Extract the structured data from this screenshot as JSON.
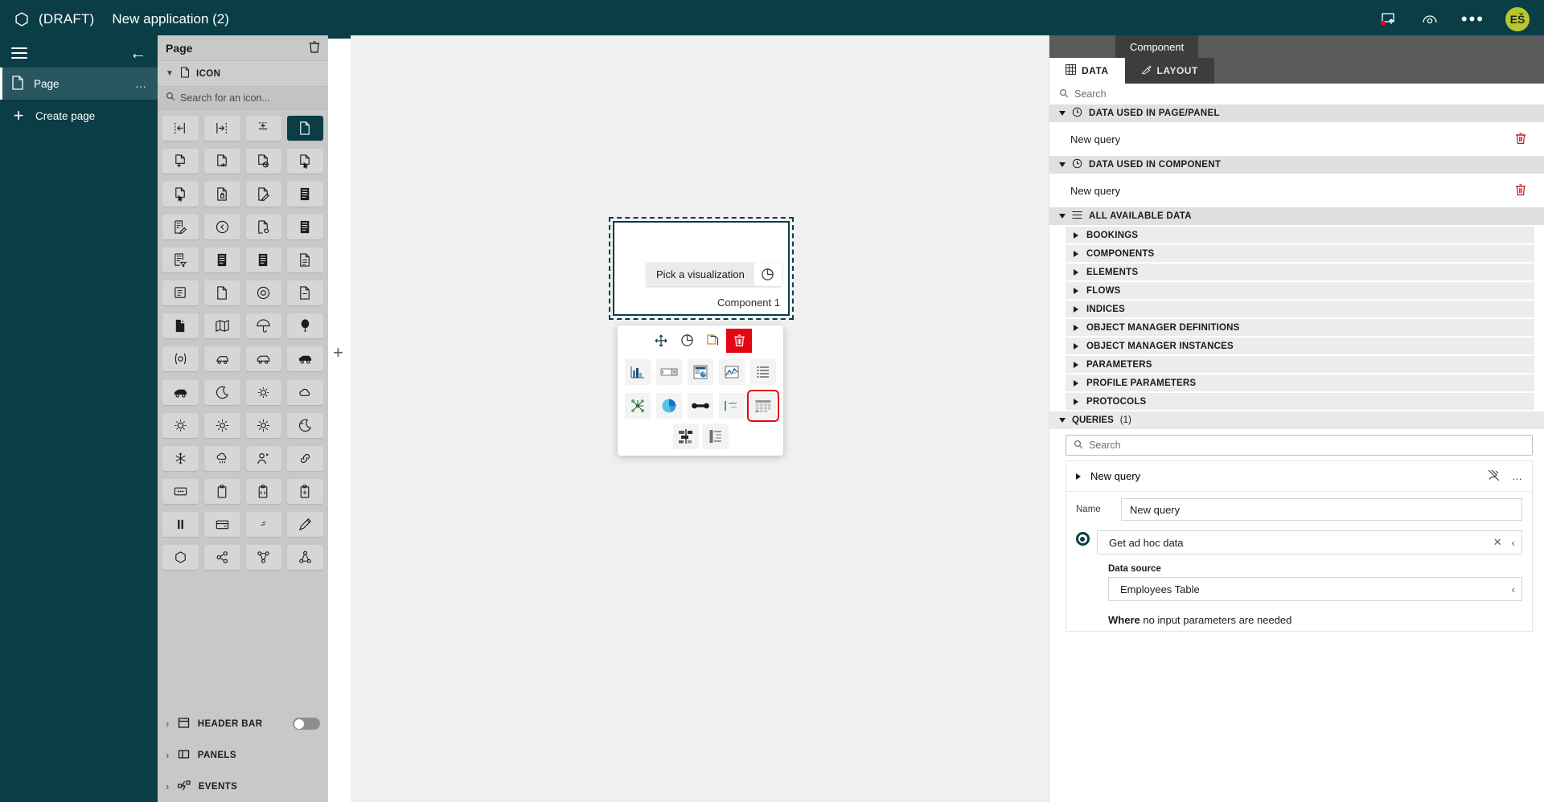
{
  "topbar": {
    "logo_icon": "hexagon-logo-icon",
    "draft_label": "(DRAFT)",
    "title": "New application (2)",
    "present_icon": "present-screen-icon",
    "preview_icon": "preview-eye-icon",
    "more_icon": "more-options-icon",
    "more_label": "•••",
    "avatar_initials": "EŠ"
  },
  "leftnav": {
    "menu_icon": "hamburger-menu-icon",
    "collapse_icon": "collapse-left-arrow-icon",
    "items": [
      {
        "label": "Page",
        "icon": "page-document-icon",
        "active": true,
        "more": "…"
      },
      {
        "label": "Create page",
        "icon": "plus-icon",
        "active": false
      }
    ]
  },
  "properties_panel": {
    "header_title": "Page",
    "delete_icon": "trash-icon",
    "icon_section": {
      "label": "ICON",
      "expanded": true,
      "icon": "page-document-icon",
      "search_placeholder": "Search for an icon...",
      "search_value": "",
      "selected_index": 3,
      "icons": [
        "align-left-icon",
        "align-right-icon",
        "align-top-icon",
        "page-blank-icon",
        "page-add-icon",
        "page-arrow-icon",
        "page-block-icon",
        "page-cursor-icon",
        "page-cursor-alt-icon",
        "page-lock-icon",
        "page-edit-icon",
        "page-lines-icon",
        "page-edit-pen-icon",
        "clock-back-icon",
        "page-link-icon",
        "list-lines-icon",
        "page-filter-icon",
        "list-dark-icon",
        "list-dark-alt-icon",
        "page-lines-alt-icon",
        "note-edit-icon",
        "page-plain-icon",
        "clock-icon",
        "page-note-icon",
        "page-fill-icon",
        "map-icon",
        "umbrella-icon",
        "balloon-icon",
        "bracket-icon",
        "car-icon",
        "car-alt-icon",
        "car-side-icon",
        "car-front-icon",
        "moon-icon",
        "sun-cloud-icon",
        "cloud-icon",
        "sun-icon",
        "sun-bright-icon",
        "sun-star-icon",
        "moon-night-icon",
        "snow-icon",
        "cloud-rain-icon",
        "person-pin-icon",
        "link-icon",
        "dots-box-icon",
        "clipboard-icon",
        "clipboard-code-icon",
        "clipboard-add-icon",
        "pause-icon",
        "card-icon",
        "feather-icon",
        "pen-icon",
        "hexagon-icon",
        "share-node-icon",
        "share-nodes-icon",
        "network-icon"
      ]
    },
    "bottom_sections": [
      {
        "label": "HEADER BAR",
        "icon": "header-bar-icon",
        "has_toggle": true,
        "toggle_on": false
      },
      {
        "label": "PANELS",
        "icon": "panels-icon",
        "has_toggle": false
      },
      {
        "label": "EVENTS",
        "icon": "events-icon",
        "has_toggle": false
      }
    ]
  },
  "canvas": {
    "add_icon": "add-component-icon",
    "component": {
      "pick_label": "Pick a visualization",
      "pick_icon": "pie-chart-icon",
      "name": "Component 1"
    },
    "vis_popup": {
      "toolbar": [
        {
          "name": "move-icon",
          "glyph": "move"
        },
        {
          "name": "pie-chart-icon",
          "glyph": "pie"
        },
        {
          "name": "copy-icon",
          "glyph": "copy"
        },
        {
          "name": "delete-icon",
          "glyph": "trash",
          "danger": true
        }
      ],
      "options_row1": [
        "bar-chart-icon",
        "input-field-icon",
        "dashboard-card-icon",
        "line-chart-icon",
        "list-view-icon"
      ],
      "options_row2": [
        "network-graph-icon",
        "pie-chart-icon",
        "gauge-bar-icon",
        "name-value-icon",
        "table-grid-icon"
      ],
      "options_row3": [
        "gantt-icon",
        "tree-list-icon"
      ],
      "selected_option": "table-grid-icon",
      "selection_color": "#e30613"
    }
  },
  "right_panel": {
    "floating_tab": "Component",
    "tabs": [
      {
        "label": "DATA",
        "icon": "grid-icon",
        "active": true
      },
      {
        "label": "LAYOUT",
        "icon": "brush-icon",
        "active": false
      }
    ],
    "search_placeholder": "Search",
    "search_value": "",
    "groups": [
      {
        "label": "DATA USED IN PAGE/PANEL",
        "icon": "history-clock-icon",
        "expanded": true,
        "rows": [
          {
            "label": "New query",
            "delete_icon": "trash-icon"
          }
        ]
      },
      {
        "label": "DATA USED IN COMPONENT",
        "icon": "history-clock-icon",
        "expanded": true,
        "rows": [
          {
            "label": "New query",
            "delete_icon": "trash-icon"
          }
        ]
      }
    ],
    "all_available_data": {
      "label": "ALL AVAILABLE DATA",
      "icon": "list-menu-icon",
      "expanded": true,
      "items": [
        "BOOKINGS",
        "COMPONENTS",
        "ELEMENTS",
        "FLOWS",
        "INDICES",
        "OBJECT MANAGER DEFINITIONS",
        "OBJECT MANAGER INSTANCES",
        "PARAMETERS",
        "PROFILE PARAMETERS",
        "PROTOCOLS"
      ]
    },
    "queries": {
      "label": "QUERIES",
      "count": "(1)",
      "expanded": true,
      "search_placeholder": "Search",
      "search_value": "",
      "card": {
        "title": "New query",
        "pin_icon": "unpin-icon",
        "more_icon": "more-options-icon",
        "more_label": "…",
        "name_label": "Name",
        "name_value": "New query",
        "action_value": "Get ad hoc data",
        "action_clear_icon": "clear-x-icon",
        "action_expand_icon": "chevron-left-icon",
        "datasource_label": "Data source",
        "datasource_value": "Employees Table",
        "datasource_expand_icon": "chevron-left-icon",
        "where_bold": "Where",
        "where_text": " no input parameters are needed"
      }
    }
  },
  "colors": {
    "brand_dark": "#0a3d46",
    "accent_red": "#e30613",
    "avatar_bg": "#b7c72e",
    "panel_grey": "#c8c8c8",
    "canvas_bg": "#f0f0f0"
  }
}
